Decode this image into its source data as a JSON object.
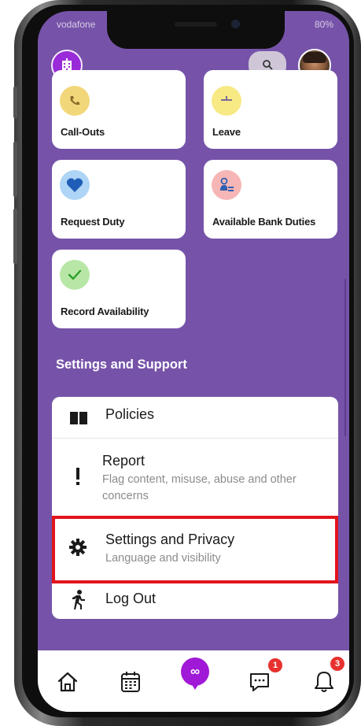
{
  "status": {
    "carrier": "vodafone",
    "battery": "80%"
  },
  "header": {
    "logo_icon": "building-icon",
    "search_icon": "search-icon",
    "avatar_icon": "user-avatar"
  },
  "grid": [
    {
      "label": "Call-Outs",
      "icon": "phone-icon",
      "icon_bg": "#f2d77a"
    },
    {
      "label": "Leave",
      "icon": "beach-icon",
      "icon_bg": "#f7ea85"
    },
    {
      "label": "Request Duty",
      "icon": "heart-icon",
      "icon_bg": "#aed4f6"
    },
    {
      "label": "Available Bank Duties",
      "icon": "people-icon",
      "icon_bg": "#f6b6b6"
    },
    {
      "label": "Record Availability",
      "icon": "check-icon",
      "icon_bg": "#b8e6a6"
    }
  ],
  "settings_section": {
    "title": "Settings and Support",
    "items": [
      {
        "title": "Policies",
        "subtitle": "",
        "icon": "book-icon"
      },
      {
        "title": "Report",
        "subtitle": "Flag content, misuse, abuse and other concerns",
        "icon": "exclamation-icon"
      },
      {
        "title": "Settings and Privacy",
        "subtitle": "Language and visibility",
        "icon": "gear-icon"
      },
      {
        "title": "Log Out",
        "subtitle": "",
        "icon": "running-person-icon"
      }
    ]
  },
  "bottom_nav": {
    "items": [
      {
        "name": "home",
        "icon": "home-icon"
      },
      {
        "name": "calendar",
        "icon": "calendar-icon"
      },
      {
        "name": "center",
        "icon": "infinity-icon",
        "symbol": "∞"
      },
      {
        "name": "messages",
        "icon": "chat-icon",
        "badge": "1"
      },
      {
        "name": "notifications",
        "icon": "bell-icon",
        "badge": "3"
      }
    ]
  },
  "colors": {
    "background": "#7653a9",
    "accent": "#a019d6",
    "highlight": "#e2141b",
    "badge": "#e8322f"
  }
}
